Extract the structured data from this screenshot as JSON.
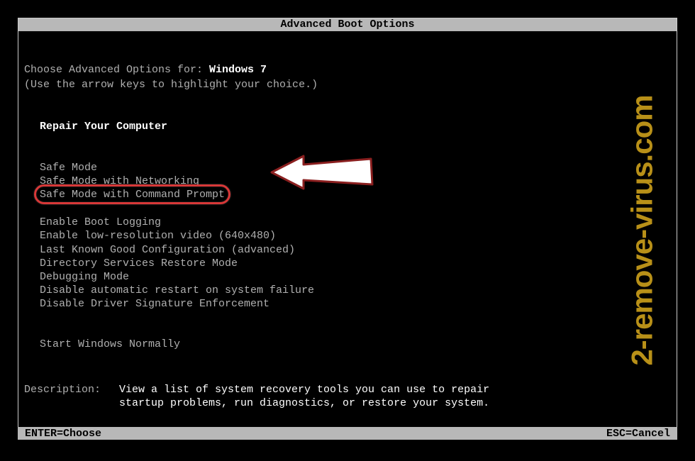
{
  "title": "Advanced Boot Options",
  "prompt_prefix": "Choose Advanced Options for: ",
  "os_name": "Windows 7",
  "hint": "(Use the arrow keys to highlight your choice.)",
  "menu": {
    "repair": "Repair Your Computer",
    "safe_mode": "Safe Mode",
    "safe_mode_net": "Safe Mode with Networking",
    "safe_mode_cmd": "Safe Mode with Command Prompt",
    "boot_log": "Enable Boot Logging",
    "lowres": "Enable low-resolution video (640x480)",
    "lkgc": "Last Known Good Configuration (advanced)",
    "dsrm": "Directory Services Restore Mode",
    "debug": "Debugging Mode",
    "no_auto_restart": "Disable automatic restart on system failure",
    "no_sig": "Disable Driver Signature Enforcement",
    "normal": "Start Windows Normally"
  },
  "description": {
    "label": "Description:",
    "text": "View a list of system recovery tools you can use to repair startup problems, run diagnostics, or restore your system."
  },
  "footer": {
    "enter": "ENTER=Choose",
    "esc": "ESC=Cancel"
  },
  "watermark": "2-remove-virus.com",
  "colors": {
    "highlight_ring": "#d83838",
    "watermark": "#b89018"
  }
}
